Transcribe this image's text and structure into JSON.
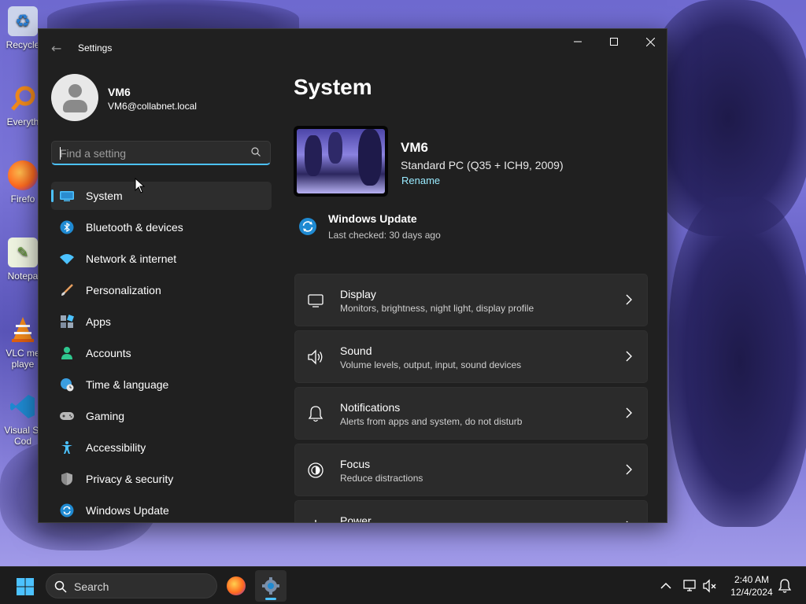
{
  "desktop": {
    "icons": [
      {
        "label": "Recycle",
        "icon": "recycle-bin-icon"
      },
      {
        "label": "Everyth",
        "icon": "everything-search-icon"
      },
      {
        "label": "Firefo",
        "icon": "firefox-icon"
      },
      {
        "label": "Notepa",
        "icon": "notepad-plus-icon"
      },
      {
        "label": "VLC me",
        "label2": "playe",
        "icon": "vlc-icon"
      },
      {
        "label": "Visual St",
        "label2": "Cod",
        "icon": "vscode-icon"
      }
    ]
  },
  "window": {
    "title": "Settings",
    "profile": {
      "name": "VM6",
      "email": "VM6@collabnet.local"
    },
    "search": {
      "placeholder": "Find a setting"
    },
    "nav": [
      {
        "label": "System",
        "icon": "system-display-icon",
        "active": true
      },
      {
        "label": "Bluetooth & devices",
        "icon": "bluetooth-icon"
      },
      {
        "label": "Network & internet",
        "icon": "wifi-icon"
      },
      {
        "label": "Personalization",
        "icon": "paintbrush-icon"
      },
      {
        "label": "Apps",
        "icon": "apps-icon"
      },
      {
        "label": "Accounts",
        "icon": "person-icon"
      },
      {
        "label": "Time & language",
        "icon": "globe-clock-icon"
      },
      {
        "label": "Gaming",
        "icon": "gamepad-icon"
      },
      {
        "label": "Accessibility",
        "icon": "accessibility-icon"
      },
      {
        "label": "Privacy & security",
        "icon": "shield-icon"
      },
      {
        "label": "Windows Update",
        "icon": "windows-update-icon"
      }
    ],
    "main": {
      "title": "System",
      "device": {
        "name": "VM6",
        "model": "Standard PC (Q35 + ICH9, 2009)",
        "rename": "Rename"
      },
      "update": {
        "title": "Windows Update",
        "subtitle": "Last checked: 30 days ago"
      },
      "cards": [
        {
          "title": "Display",
          "subtitle": "Monitors, brightness, night light, display profile",
          "icon": "monitor-icon"
        },
        {
          "title": "Sound",
          "subtitle": "Volume levels, output, input, sound devices",
          "icon": "speaker-icon"
        },
        {
          "title": "Notifications",
          "subtitle": "Alerts from apps and system, do not disturb",
          "icon": "bell-icon"
        },
        {
          "title": "Focus",
          "subtitle": "Reduce distractions",
          "icon": "focus-icon"
        },
        {
          "title": "Power",
          "subtitle": "",
          "icon": "power-icon"
        }
      ]
    }
  },
  "taskbar": {
    "search_label": "Search",
    "clock": {
      "time": "2:40 AM",
      "date": "12/4/2024"
    }
  },
  "colors": {
    "accent": "#4cc2ff",
    "link": "#99ebff",
    "window_bg": "#202020",
    "card_bg": "#2b2b2b"
  }
}
